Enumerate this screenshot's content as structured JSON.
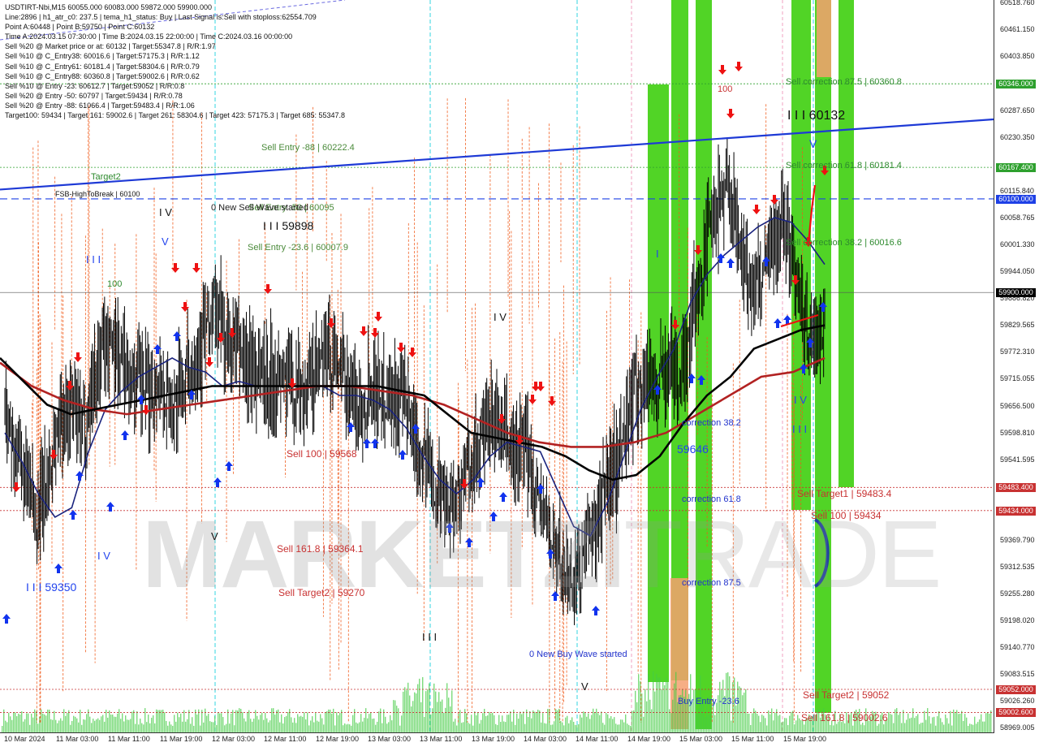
{
  "chart_data": {
    "type": "candlestick",
    "symbol": "USDTIRT-Nbi",
    "timeframe": "M15",
    "title": "USDTIRT-Nbi,M15  60055.000 60083.000 59872.000 59900.000",
    "info_lines": [
      "Line:2896 | h1_atr_c0: 237.5 | tema_h1_status: Buy | Last Signal is:Sell with stoploss:62554.709",
      "Point A:60448 | Point B:59750 | Point C:60132",
      "Time A:2024.03.15 07:30:00 | Time B:2024.03.15 22:00:00 | Time C:2024.03.16 00:00:00",
      "Sell %20 @ Market price or at: 60132 | Target:55347.8 | R/R:1.97",
      "Sell %10 @ C_Entry38: 60016.6 | Target:57175.3 | R/R:1.12",
      "Sell %10 @ C_Entry61: 60181.4 | Target:58304.6 | R/R:0.79",
      "Sell %10 @ C_Entry88: 60360.8 | Target:59002.6 | R/R:0.62",
      "Sell %10 @ Entry -23: 60612.7 | Target:59052 | R/R:0.8",
      "Sell %20 @ Entry -50: 60797 | Target:59434 | R/R:0.78",
      "Sell %20 @ Entry -88: 61066.4 | Target:59483.4 | R/R:1.06",
      "Target100: 59434 | Target 161: 59002.6 | Target 261: 58304.6 | Target 423: 57175.3 | Target 685: 55347.8"
    ],
    "y_ticks": [
      "60518.760",
      "60461.150",
      "60403.850",
      "60287.650",
      "60230.350",
      "60115.840",
      "60058.765",
      "60001.330",
      "59944.050",
      "59886.820",
      "59829.565",
      "59772.310",
      "59715.055",
      "59656.500",
      "59598.810",
      "59541.595",
      "59369.790",
      "59312.535",
      "59255.280",
      "59198.020",
      "59140.770",
      "59083.515",
      "59026.260",
      "58969.005"
    ],
    "price_tags": [
      {
        "label": "60346.000",
        "value": 60346,
        "color": "#2ea02e"
      },
      {
        "label": "60167.400",
        "value": 60167.4,
        "color": "#2ea02e"
      },
      {
        "label": "60100.000",
        "value": 60100,
        "color": "#1e40e6"
      },
      {
        "label": "59900.000",
        "value": 59900,
        "color": "#000000"
      },
      {
        "label": "59483.400",
        "value": 59483.4,
        "color": "#c83232"
      },
      {
        "label": "59434.000",
        "value": 59434,
        "color": "#c83232"
      },
      {
        "label": "59052.000",
        "value": 59052,
        "color": "#c83232"
      },
      {
        "label": "59002.600",
        "value": 59002.6,
        "color": "#c83232"
      }
    ],
    "x_ticks": [
      "10 Mar 2024",
      "11 Mar 03:00",
      "11 Mar 11:00",
      "11 Mar 19:00",
      "12 Mar 03:00",
      "12 Mar 11:00",
      "12 Mar 19:00",
      "13 Mar 03:00",
      "13 Mar 11:00",
      "13 Mar 19:00",
      "14 Mar 03:00",
      "14 Mar 11:00",
      "14 Mar 19:00",
      "15 Mar 03:00",
      "15 Mar 11:00",
      "15 Mar 19:00"
    ],
    "ylim": [
      58960,
      60525
    ],
    "horizontal_levels": [
      {
        "label": "Sell correction 87.5 | 60360.8",
        "value": 60346,
        "color": "#2ea02e"
      },
      {
        "label": "Sell correction 61.8 | 60181.4",
        "value": 60167.4,
        "color": "#2ea02e"
      },
      {
        "label": "FSB-HighToBreak | 60100",
        "value": 60100,
        "color": "#1e40e6"
      },
      {
        "label": "Sell Target1 | 59483.4",
        "value": 59483.4,
        "color": "#c83232"
      },
      {
        "label": "Sell 100 | 59434",
        "value": 59434,
        "color": "#c83232"
      },
      {
        "label": "Sell Target2 | 59052",
        "value": 59052,
        "color": "#c83232"
      },
      {
        "label": "Sell 161.8 | 59002.6",
        "value": 59002.6,
        "color": "#c83232"
      }
    ],
    "close_series_approx": [
      59650,
      59560,
      59470,
      59420,
      59520,
      59640,
      59660,
      59600,
      59720,
      59800,
      59780,
      59740,
      59700,
      59690,
      59720,
      59650,
      59700,
      59760,
      59810,
      59870,
      59790,
      59780,
      59750,
      59730,
      59720,
      59720,
      59700,
      59690,
      59720,
      59770,
      59740,
      59710,
      59650,
      59720,
      59690,
      59680,
      59650,
      59600,
      59540,
      59480,
      59450,
      59470,
      59540,
      59580,
      59620,
      59590,
      59560,
      59560,
      59480,
      59390,
      59330,
      59280,
      59320,
      59390,
      59460,
      59520,
      59620,
      59690,
      59720,
      59700,
      59760,
      59700,
      59860,
      59960,
      60050,
      60150,
      60050,
      59920,
      59930,
      60000,
      60040,
      60020,
      59840,
      59780,
      59860
    ],
    "ema_fast_approx": [
      59600,
      59540,
      59470,
      59420,
      59440,
      59560,
      59650,
      59690,
      59720,
      59740,
      59760,
      59740,
      59730,
      59700,
      59710,
      59700,
      59700,
      59700,
      59700,
      59700,
      59680,
      59680,
      59670,
      59650,
      59610,
      59550,
      59500,
      59470,
      59500,
      59550,
      59580,
      59570,
      59560,
      59480,
      59400,
      59380,
      59450,
      59550,
      59650,
      59720,
      59780,
      59880,
      59940,
      59980,
      60010,
      60040,
      60060,
      60050,
      60010,
      59960
    ],
    "ema_mid_approx": [
      59760,
      59710,
      59660,
      59640,
      59650,
      59660,
      59670,
      59680,
      59690,
      59700,
      59700,
      59700,
      59700,
      59700,
      59700,
      59700,
      59700,
      59690,
      59680,
      59640,
      59600,
      59590,
      59580,
      59570,
      59550,
      59520,
      59500,
      59510,
      59550,
      59620,
      59680,
      59720,
      59780,
      59800,
      59820,
      59830
    ],
    "ema_slow_approx": [
      59750,
      59700,
      59670,
      59650,
      59640,
      59650,
      59660,
      59670,
      59680,
      59690,
      59700,
      59700,
      59690,
      59680,
      59660,
      59630,
      59600,
      59580,
      59570,
      59570,
      59580,
      59600,
      59640,
      59680,
      59720,
      59730,
      59760
    ]
  },
  "annotations": {
    "sell_entry_88": "Sell Entry -88 | 60222.4",
    "sell_entry_50": "Sell Entry -50 | 60095",
    "new_sell_wave": "0 New Sell Wave started",
    "wave_label_iii_59898": "I I I 59898",
    "sell_entry_23": "Sell Entry -23.6 | 60007.9",
    "target2_green": "Target2",
    "fsb": "FSB-HighToBreak | 60100",
    "hundred": "100",
    "wave_iv_top": "I V",
    "wave_iii_blue": "I I I",
    "wave_iv_blue": "I V",
    "wave_iii_59350": "I I I 59350",
    "wave_v": "V",
    "sell_100": "Sell 100 | 59568",
    "sell_161": "Sell 161.8 | 59364.1",
    "sell_target2_left": "Sell Target2 | 59270",
    "wave_iv_mid": "I V",
    "wave_iii_low": "I I I",
    "new_buy_wave": "0 New Buy Wave started",
    "wave_v_low": "V",
    "wave_i_green": "I",
    "buy_59646": "59646",
    "correction_38": "correction 38.2",
    "correction_61": "correction 61.8",
    "correction_87": "correction 87.5",
    "buy_entry_23": "Buy Entry -23.6",
    "iii_60132": "I I I 60132",
    "wave_v_right": "V",
    "sell_corr_875": "Sell correction 87.5 | 60360.8",
    "sell_corr_618": "Sell correction 61.8 | 60181.4",
    "sell_corr_382": "Sell correction 38.2 | 60016.6",
    "wave_iv_right": "I V",
    "wave_iii_right": "I I I",
    "sell_target1": "Sell Target1 | 59483.4",
    "sell_100_right": "Sell 100 | 59434",
    "sell_target2": "Sell Target2 | 59052",
    "sell_161_right": "Sell 161.8 | 59002.6",
    "hundred_right": "100"
  },
  "watermark": {
    "bold": "MARKETZI",
    "thin": "TRADE"
  },
  "colors": {
    "bull_bear_candles": "#000000",
    "ema_fast": "#1a237e",
    "ema_mid": "#000000",
    "ema_slow": "#b22222",
    "trendline": "#1e3ad6",
    "orange_lines": "#f05a1a",
    "cyan_lines": "#33d6e0",
    "pink_lines": "#f0a0c0",
    "green_zones": "#33cc00",
    "volume": "#44cc44",
    "sell_arrow": "#ee1111",
    "buy_arrow": "#1133ee"
  }
}
